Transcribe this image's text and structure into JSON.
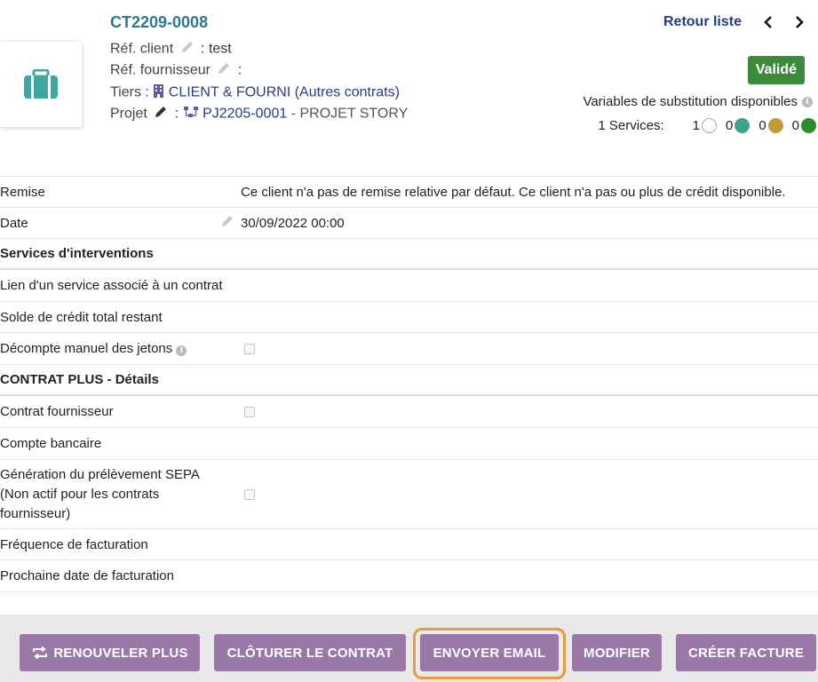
{
  "header": {
    "ref": "CT2209-0008",
    "ref_client_label": "Réf. client",
    "ref_client_value": ": test",
    "ref_fournisseur_label": "Réf. fournisseur",
    "ref_fournisseur_value": ":",
    "tiers_label": "Tiers :",
    "tiers_name": "CLIENT & FOURNI",
    "tiers_link": "(Autres contrats)",
    "projet_label": "Projet",
    "projet_sep": ":",
    "projet_ref": "PJ2205-0001",
    "projet_name": "- PROJET STORY",
    "retour_liste": "Retour liste",
    "status": "Validé",
    "substitution": "Variables de substitution disponibles",
    "services_label": "1 Services:",
    "service_counts": [
      "1",
      "0",
      "0",
      "0"
    ],
    "status_colors": [
      "#ffffff",
      "#3da38a",
      "#bf9a37",
      "#2f8a2f"
    ]
  },
  "rows": {
    "remise_label": "Remise",
    "remise_value": "Ce client n'a pas de remise relative par défaut. Ce client n'a pas ou plus de crédit disponible.",
    "date_label": "Date",
    "date_value": "30/09/2022 00:00",
    "section1": "Services d'interventions",
    "lien_label": "Lien d'un service associé à un contrat",
    "solde_label": "Solde de crédit total restant",
    "decompte_label": "Décompte manuel des jetons",
    "section2": "CONTRAT PLUS - Détails",
    "contrat_fournisseur_label": "Contrat fournisseur",
    "compte_bancaire_label": "Compte bancaire",
    "sepa_line1": "Génération du prélèvement SEPA",
    "sepa_line2": "(Non actif pour les contrats",
    "sepa_line3": "fournisseur)",
    "frequence_label": "Fréquence de facturation",
    "prochaine_label": "Prochaine date de facturation"
  },
  "buttons": {
    "renouveler": "RENOUVELER PLUS",
    "cloturer": "CLÔTURER LE CONTRAT",
    "envoyer": "ENVOYER EMAIL",
    "modifier": "MODIFIER",
    "creer_facture": "CRÉER FACTURE"
  },
  "colors": {
    "accent_teal": "#2b7a86",
    "link_navy": "#263c84",
    "button_purple": "#9a79a8",
    "highlight_orange": "#e99a3c",
    "status_green": "#3c8b3a"
  }
}
